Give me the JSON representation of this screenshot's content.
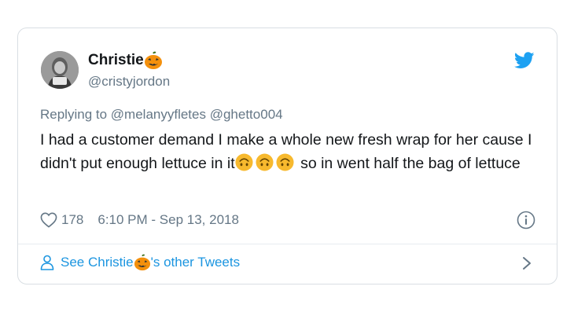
{
  "tweet": {
    "author_name": "Christie",
    "handle": "@cristyjordon",
    "replying_prefix": "Replying to",
    "replying_to": "@melanyyfletes @ghetto004",
    "text_part1": "I had a customer demand I make a whole new fresh wrap for her cause I didn't put enough lettuce in it",
    "text_part2": " so in went half the bag of lettuce",
    "like_count": "178",
    "timestamp": "6:10 PM - Sep 13, 2018"
  },
  "footer": {
    "link_prefix": "See Christie",
    "link_suffix": "'s other Tweets"
  },
  "icons": {
    "pumpkin": "jack-o-lantern-icon",
    "upside_down": "upside-down-face-icon",
    "logo": "twitter-bird-icon",
    "heart": "heart-outline-icon",
    "info": "info-icon",
    "person": "person-icon",
    "chevron": "chevron-right-icon"
  },
  "colors": {
    "text": "#14171a",
    "muted": "#657786",
    "link": "#1b95e0",
    "brand": "#1da1f2",
    "emoji_yellow": "#f7b92e",
    "pumpkin_orange": "#f4900c"
  }
}
